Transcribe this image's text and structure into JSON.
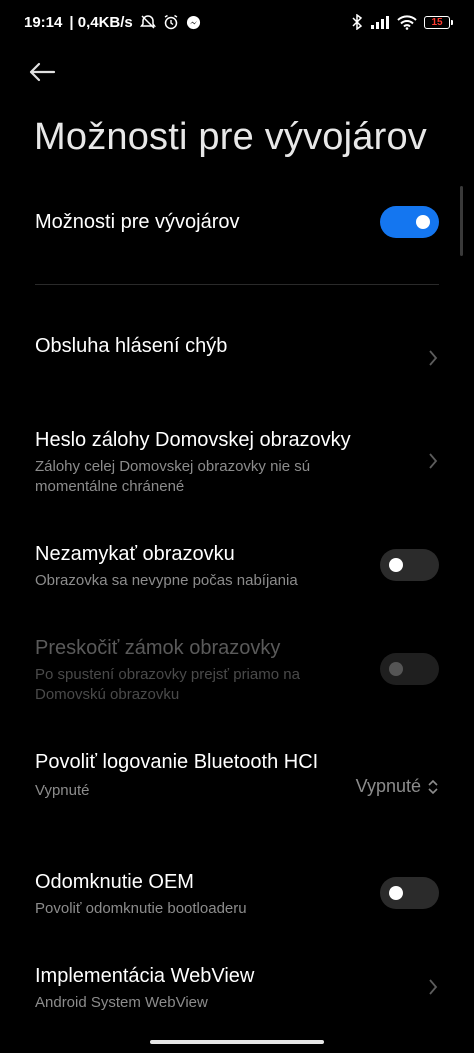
{
  "status": {
    "time": "19:14",
    "network_speed": "| 0,4KB/s",
    "battery": "15",
    "icons": [
      "alarm-off-icon",
      "alarm-icon",
      "messenger-icon",
      "bluetooth-icon",
      "signal-icon",
      "wifi-icon",
      "battery-icon"
    ]
  },
  "header": {
    "back_icon": "back-arrow-icon",
    "title": "Možnosti pre vývojárov"
  },
  "master_toggle": {
    "label": "Možnosti pre vývojárov",
    "on": true
  },
  "settings": [
    {
      "title": "Obsluha hlásení chýb",
      "subtitle": "",
      "control": "chevron"
    },
    {
      "title": "Heslo zálohy Domovskej obrazovky",
      "subtitle": "Zálohy celej Domovskej obrazovky nie sú momentálne chránené",
      "control": "chevron"
    },
    {
      "title": "Nezamykať obrazovku",
      "subtitle": "Obrazovka sa nevypne počas nabíjania",
      "control": "toggle",
      "on": false
    },
    {
      "title": "Preskočiť zámok obrazovky",
      "subtitle": "Po spustení obrazovky prejsť priamo na Domovskú obrazovku",
      "control": "toggle",
      "on": false,
      "disabled": true
    },
    {
      "title": "Povoliť logovanie Bluetooth HCI",
      "subtitle": "Vypnuté",
      "control": "select",
      "value": "Vypnuté"
    },
    {
      "title": "Odomknutie OEM",
      "subtitle": "Povoliť odomknutie bootloaderu",
      "control": "toggle",
      "on": false
    },
    {
      "title": "Implementácia WebView",
      "subtitle": "Android System WebView",
      "control": "chevron"
    }
  ],
  "colors": {
    "background": "#000000",
    "accent": "#1476f0",
    "secondary_text": "#8c8c8c"
  }
}
